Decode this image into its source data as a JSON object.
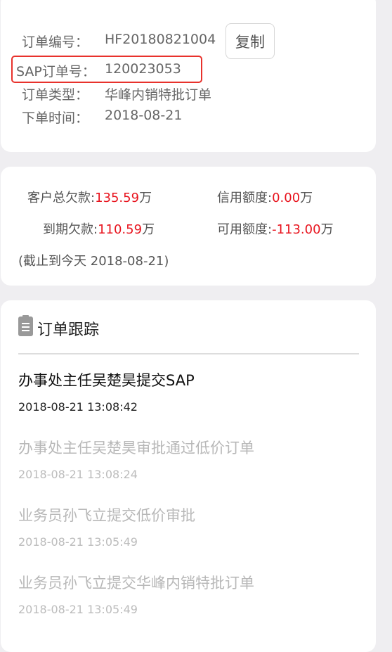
{
  "order": {
    "number_label": "订单编号：",
    "number": "HF20180821004",
    "copy_label": "复制",
    "sap_label": "SAP订单号：",
    "sap": "120023053",
    "type_label": "订单类型：",
    "type": "华峰内销特批订单",
    "time_label": "下单时间：",
    "time": "2018-08-21"
  },
  "finance": {
    "total_debt_label": "客户总欠款:",
    "total_debt": "135.59",
    "credit_label": "信用额度:",
    "credit": "0.00",
    "due_label": "到期欠款:",
    "due": "110.59",
    "available_label": "可用额度:",
    "available": "-113.00",
    "unit": "万",
    "as_of": "(截止到今天 2018-08-21)"
  },
  "tracking": {
    "title": "订单跟踪",
    "events": [
      {
        "text": "办事处主任吴楚昊提交SAP",
        "time": "2018-08-21 13:08:42"
      },
      {
        "text": "办事处主任吴楚昊审批通过低价订单",
        "time": "2018-08-21 13:08:24"
      },
      {
        "text": "业务员孙飞立提交低价审批",
        "time": "2018-08-21 13:05:49"
      },
      {
        "text": "业务员孙飞立提交华峰内销特批订单",
        "time": "2018-08-21 13:05:49"
      }
    ]
  }
}
